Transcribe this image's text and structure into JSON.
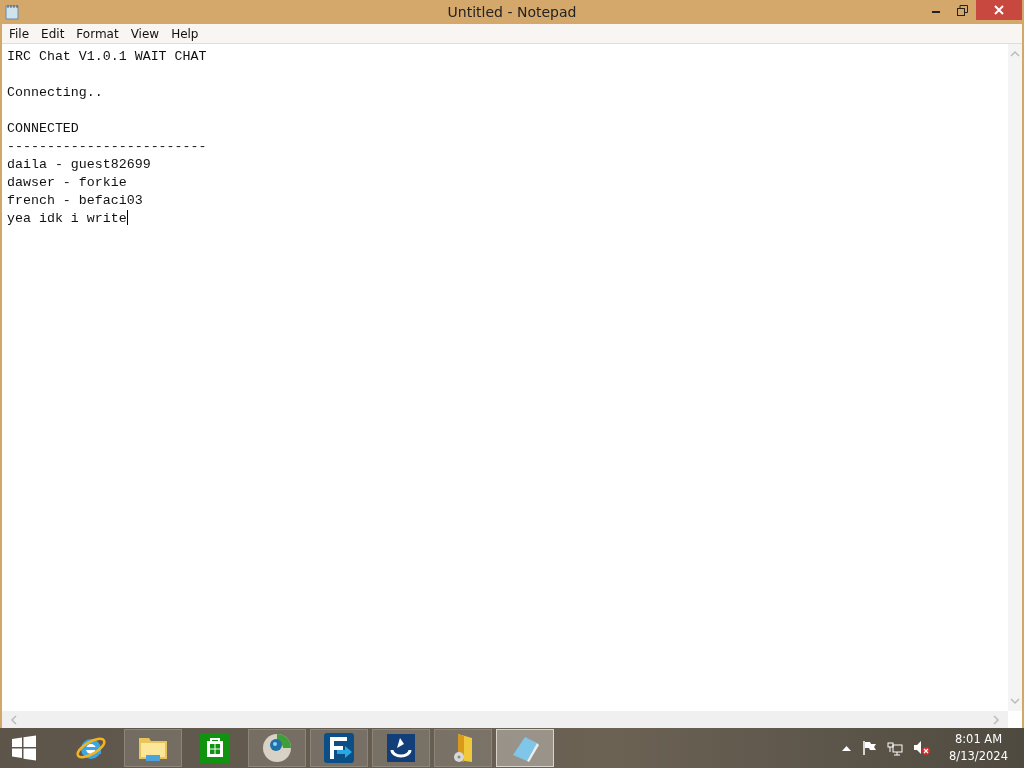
{
  "window": {
    "title": "Untitled - Notepad"
  },
  "menu": [
    "File",
    "Edit",
    "Format",
    "View",
    "Help"
  ],
  "document": {
    "text": "IRC Chat V1.0.1 WAIT CHAT\n\nConnecting..\n\nCONNECTED\n-------------------------\ndaila - guest82699\ndawser - forkie\nfrench - befaci03\nyea idk i write"
  },
  "taskbar": {
    "apps": [
      {
        "kind": "browser-e",
        "running": false,
        "selected": false
      },
      {
        "kind": "folder",
        "running": true,
        "selected": false
      },
      {
        "kind": "store",
        "running": false,
        "selected": false
      },
      {
        "kind": "globe",
        "running": true,
        "selected": false
      },
      {
        "kind": "transfer",
        "running": true,
        "selected": false
      },
      {
        "kind": "sync",
        "running": true,
        "selected": false
      },
      {
        "kind": "media",
        "running": true,
        "selected": false
      },
      {
        "kind": "notepad",
        "running": true,
        "selected": true
      }
    ],
    "time": "8:01 AM",
    "date": "8/13/2024"
  }
}
